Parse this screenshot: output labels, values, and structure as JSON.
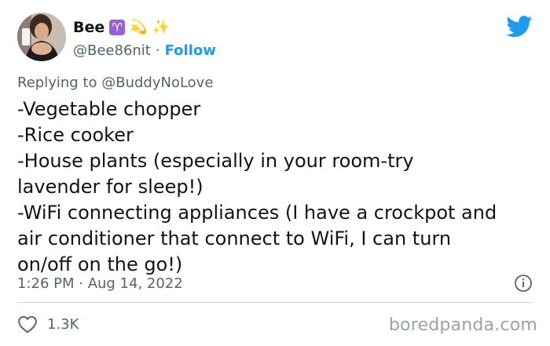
{
  "user": {
    "display_name": "Bee",
    "handle": "@Bee86nit",
    "separator": "·",
    "follow_label": "Follow",
    "emoji_aries": "♈",
    "emoji_dizzy": "💫",
    "emoji_sparkles": "✨"
  },
  "reply": {
    "prefix": "Replying to",
    "mention": "@BuddyNoLove"
  },
  "tweet": {
    "lines": [
      "-Vegetable chopper",
      "-Rice cooker",
      "-House plants (especially in your room-try",
      "lavender for sleep!)",
      "-WiFi connecting appliances (I have a crockpot and",
      "air conditioner that connect to WiFi, I can turn",
      "on/off on the go!)"
    ]
  },
  "meta": {
    "timestamp": "1:26 PM · Aug 14, 2022"
  },
  "engagement": {
    "likes": "1.3K"
  },
  "watermark": "boredpanda.com",
  "colors": {
    "accent": "#1d9bf0",
    "text": "#0f1419",
    "muted": "#536471",
    "divider": "#cfd9de"
  },
  "icons": {
    "bird": "twitter-bird-icon",
    "info": "info-icon",
    "heart": "heart-icon"
  }
}
